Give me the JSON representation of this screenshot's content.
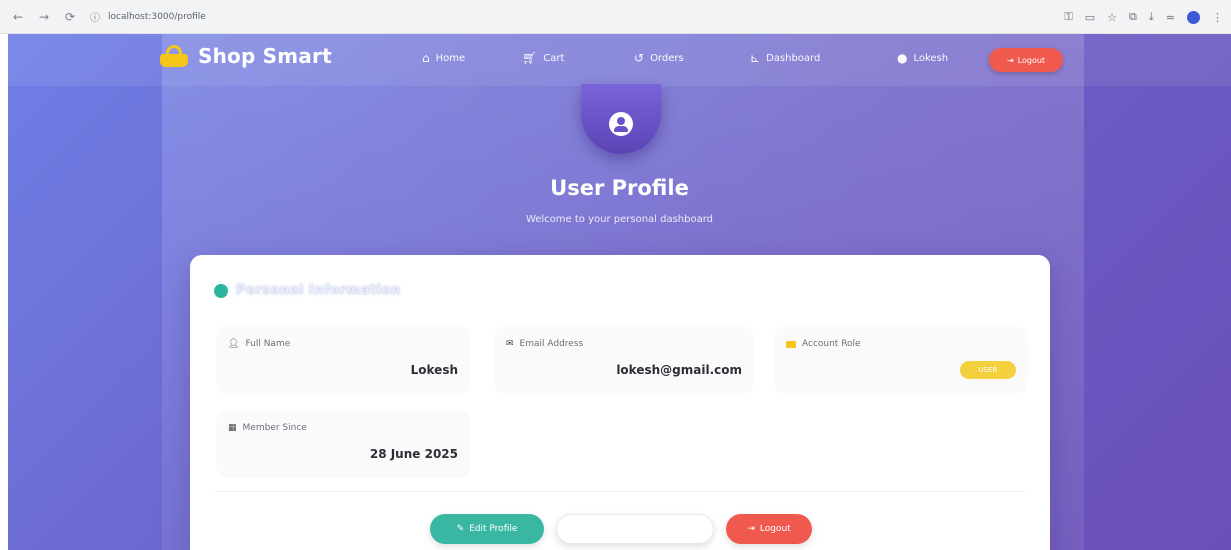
{
  "browser": {
    "nav_back": "←",
    "nav_forward": "→",
    "nav_reload": "⟳",
    "url": "localhost:3000/profile"
  },
  "navbar": {
    "brand": "Shop Smart",
    "items": [
      {
        "icon": "home-icon",
        "label": "Home"
      },
      {
        "icon": "cart-icon",
        "label": "Cart"
      },
      {
        "icon": "orders-icon",
        "label": "Orders"
      },
      {
        "icon": "dashboard-icon",
        "label": "Dashboard"
      },
      {
        "icon": "user-icon",
        "label": "Lokesh"
      }
    ],
    "logout_label": "Logout"
  },
  "header": {
    "title": "User Profile",
    "subtitle": "Welcome to your personal dashboard"
  },
  "card": {
    "section_title": "Personal Information",
    "fields": {
      "full_name": {
        "label": "Full Name",
        "value": "Lokesh"
      },
      "email": {
        "label": "Email Address",
        "value": "lokesh@gmail.com"
      },
      "role": {
        "label": "Account Role",
        "value": "USER"
      },
      "member_since": {
        "label": "Member Since",
        "value": "28 June 2025"
      }
    },
    "buttons": {
      "edit": "Edit Profile",
      "logout": "Logout"
    }
  },
  "colors": {
    "accent_teal": "#3ab7a3",
    "logout_red": "#f05a4e",
    "badge_yellow": "#f4d03f",
    "bg_start": "#6f7fe6",
    "bg_end": "#6b4fb8"
  }
}
